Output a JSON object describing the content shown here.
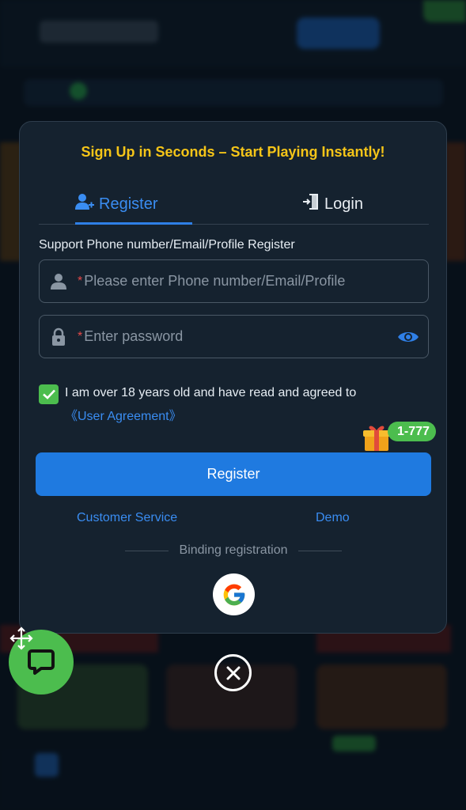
{
  "colors": {
    "accent": "#2f7fe6",
    "headline": "#f5c518",
    "success": "#4cbd4e",
    "modal_bg": "#15222f",
    "required": "#e54848"
  },
  "modal": {
    "headline": "Sign Up in Seconds – Start Playing Instantly!",
    "tabs": [
      {
        "label": "Register",
        "icon": "user-plus-icon",
        "active": true
      },
      {
        "label": "Login",
        "icon": "login-door-icon",
        "active": false
      }
    ],
    "support_text": "Support Phone number/Email/Profile Register",
    "fields": {
      "phone": {
        "required_mark": "*",
        "placeholder": "Please enter Phone number/Email/Profile",
        "value": "",
        "icon": "user-icon"
      },
      "password": {
        "required_mark": "*",
        "placeholder": "Enter password",
        "value": "",
        "icon": "lock-icon",
        "toggle_icon": "eye-icon"
      }
    },
    "agreement": {
      "checked": true,
      "text": "I am over 18 years old and have read and agreed to",
      "link": "《User Agreement》"
    },
    "bonus_badge": "1-777",
    "register_button": "Register",
    "links": {
      "customer_service": "Customer Service",
      "demo": "Demo"
    },
    "binding_label": "Binding registration",
    "social": [
      {
        "name": "google",
        "icon": "google-icon"
      }
    ]
  },
  "floating": {
    "chat_icon": "chat-bubble-icon",
    "move_icon": "move-arrows-icon",
    "close_icon": "close-icon"
  }
}
